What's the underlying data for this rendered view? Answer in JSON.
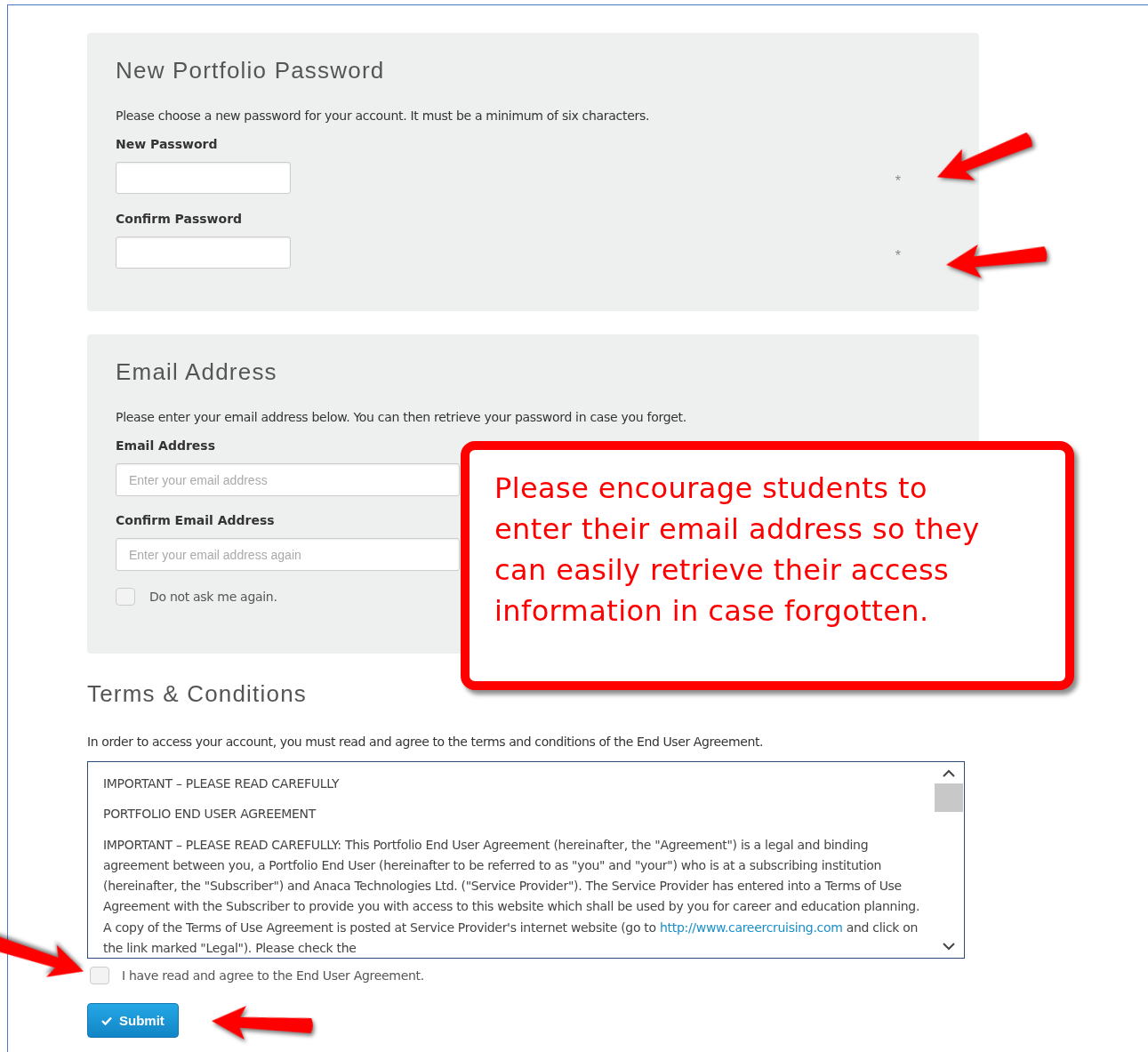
{
  "password_panel": {
    "title": "New Portfolio Password",
    "description": "Please choose a new password for your account. It must be a minimum of six characters.",
    "fields": [
      {
        "label": "New Password",
        "required_mark": "*"
      },
      {
        "label": "Confirm Password",
        "required_mark": "*"
      }
    ]
  },
  "email_panel": {
    "title": "Email Address",
    "description": "Please enter your email address below. You can then retrieve your password in case you forget.",
    "fields": [
      {
        "label": "Email Address",
        "placeholder": "Enter your email address"
      },
      {
        "label": "Confirm Email Address",
        "placeholder": "Enter your email address again"
      }
    ],
    "checkbox": {
      "label": "Do not ask me again.",
      "checked": false
    }
  },
  "terms": {
    "title": "Terms & Conditions",
    "description": "In order to access your account, you must read and agree to the terms and conditions of the End User Agreement.",
    "agreement": {
      "heading_1": "IMPORTANT – PLEASE READ CAREFULLY",
      "heading_2": "PORTFOLIO END USER AGREEMENT",
      "paragraph_before_link": "IMPORTANT – PLEASE READ CAREFULLY: This Portfolio End User Agreement (hereinafter, the \"Agreement\") is a legal and binding agreement between you, a Portfolio End User (hereinafter to be referred to as \"you\" and \"your\") who is at a subscribing institution (hereinafter, the \"Subscriber\") and Anaca Technologies Ltd. (\"Service Provider\"). The Service Provider has entered into a Terms of Use Agreement with the Subscriber to provide you with access to this website which shall be used by you for career and education planning. A copy of the Terms of Use Agreement is posted at Service Provider's internet website (go to",
      "link": "http://www.careercruising.com",
      "paragraph_after_link": "and click on the link marked \"Legal\"). Please check the"
    },
    "checkbox": {
      "label": "I have read and agree to the End User Agreement.",
      "checked": false
    },
    "submit": "Submit"
  },
  "callout": {
    "text": "Please encourage students to enter their email address so they can easily retrieve their access information in case forgotten."
  }
}
